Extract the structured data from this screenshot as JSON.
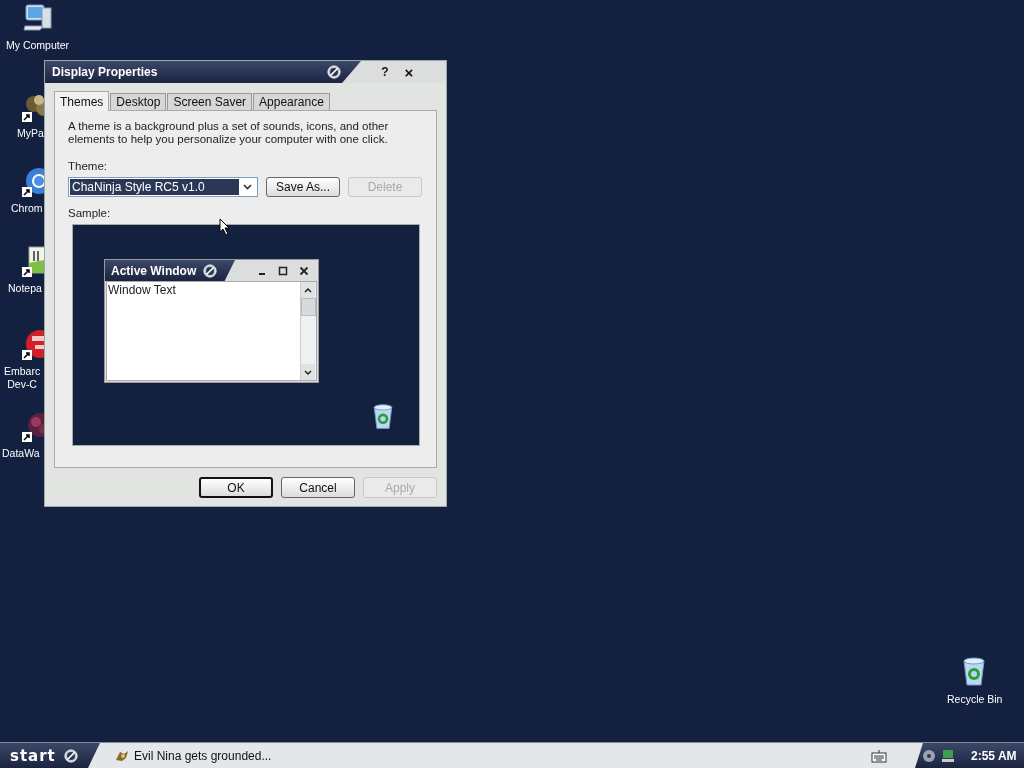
{
  "desktop_icons": [
    {
      "kind": "computer",
      "label": "My Computer",
      "shortcut": false
    },
    {
      "kind": "photo-app",
      "label": "MyPa",
      "shortcut": true
    },
    {
      "kind": "browser",
      "label": "Chrom",
      "shortcut": true
    },
    {
      "kind": "notepad",
      "label": "Notepa",
      "shortcut": true
    },
    {
      "kind": "ide",
      "label": "Embarc\nDev-C",
      "shortcut": true
    },
    {
      "kind": "visualizer",
      "label": "DataWa",
      "shortcut": true
    },
    {
      "kind": "recycle-bin",
      "label": "Recycle Bin",
      "shortcut": false
    }
  ],
  "window": {
    "title": "Display Properties",
    "help": "?",
    "close": "×"
  },
  "tabs": [
    {
      "label": "Themes",
      "selected": true
    },
    {
      "label": "Desktop",
      "selected": false
    },
    {
      "label": "Screen Saver",
      "selected": false
    },
    {
      "label": "Appearance",
      "selected": false
    }
  ],
  "description": "A theme is a background plus a set of sounds, icons, and other elements to help you personalize your computer with one click.",
  "theme": {
    "label": "Theme:",
    "value": "ChaNinja Style RC5 v1.0"
  },
  "theme_buttons": [
    {
      "label": "Save As...",
      "disabled": false
    },
    {
      "label": "Delete",
      "disabled": true
    }
  ],
  "sample": {
    "label": "Sample:",
    "window_title": "Active Window",
    "window_text": "Window Text"
  },
  "buttons": [
    {
      "label": "OK",
      "default": true,
      "disabled": false
    },
    {
      "label": "Cancel",
      "default": false,
      "disabled": false
    },
    {
      "label": "Apply",
      "default": false,
      "disabled": true
    }
  ],
  "taskbar": {
    "start": "start",
    "tasks": [
      {
        "label": "Evil Nina gets grounded..."
      }
    ],
    "clock": "2:55 AM"
  }
}
